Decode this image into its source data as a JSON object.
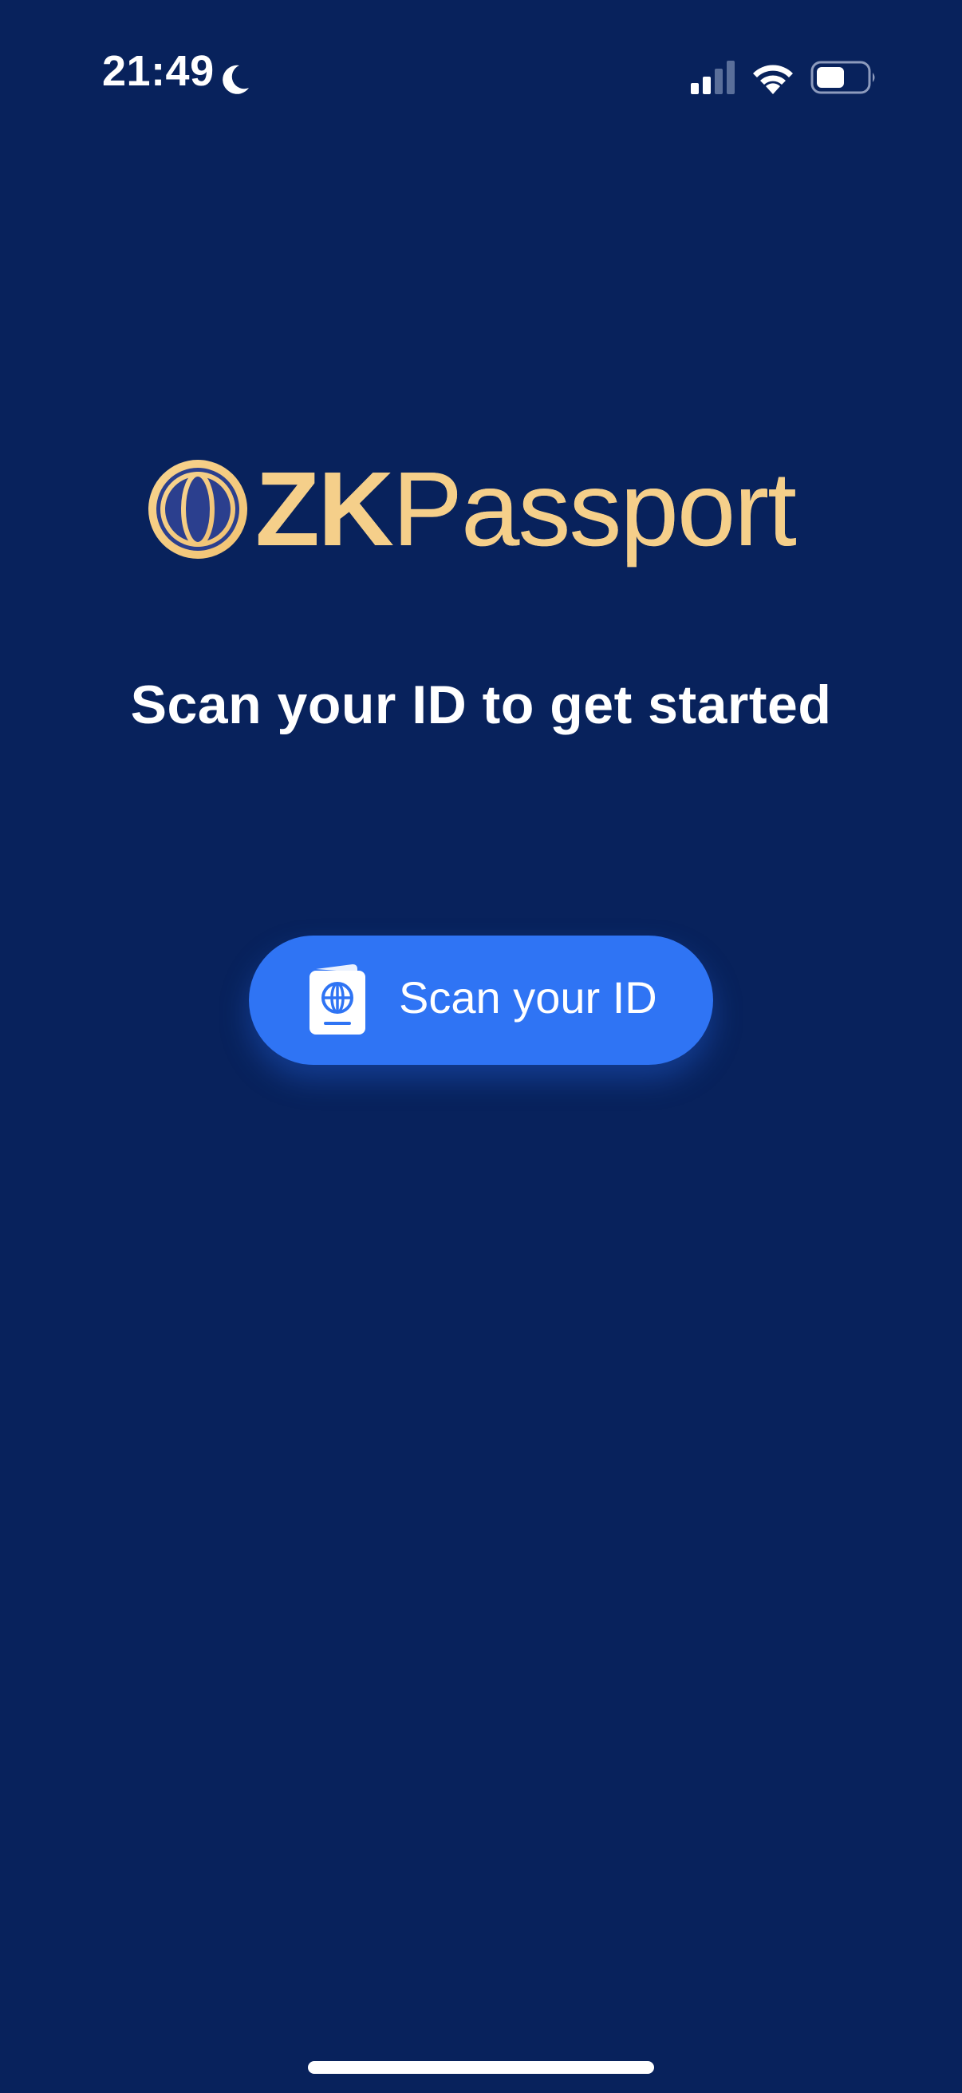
{
  "status_bar": {
    "time": "21:49",
    "icons": [
      "moon-icon",
      "cellular-signal-icon",
      "wifi-icon",
      "battery-icon"
    ]
  },
  "logo": {
    "bold_text": "ZK",
    "light_text": "Passport",
    "icon": "globe-icon"
  },
  "heading": "Scan your ID to get started",
  "scan_button": {
    "label": "Scan your ID",
    "icon": "passport-icon"
  },
  "colors": {
    "background": "#08225c",
    "accent": "#2f74f4",
    "logo_gold": "#f5cf8a",
    "text": "#ffffff"
  }
}
